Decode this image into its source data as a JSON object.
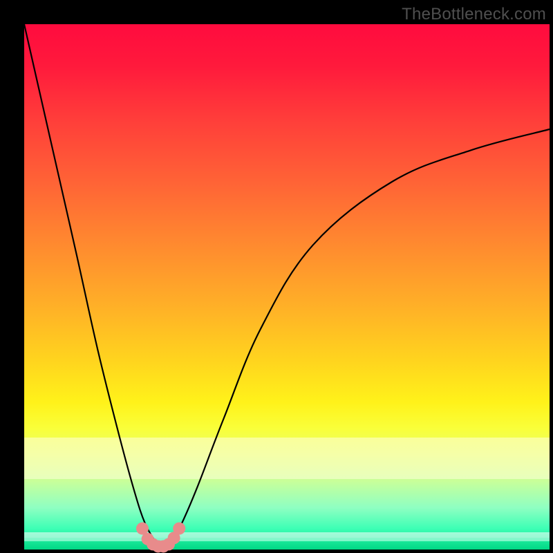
{
  "watermark": "TheBottleneck.com",
  "colors": {
    "curve_stroke": "#000000",
    "marker_fill": "#e88b8b",
    "marker_stroke": "#c96464"
  },
  "chart_data": {
    "type": "line",
    "title": "",
    "xlabel": "",
    "ylabel": "",
    "xlim": [
      0,
      100
    ],
    "ylim": [
      0,
      100
    ],
    "grid": false,
    "series": [
      {
        "name": "bottleneck-curve",
        "x": [
          0,
          5,
          10,
          14,
          18,
          21,
          23,
          25,
          26,
          27,
          28,
          30,
          33,
          38,
          45,
          55,
          70,
          85,
          100
        ],
        "values": [
          100,
          78,
          56,
          38,
          22,
          11,
          5,
          1.5,
          0.5,
          0.5,
          1.5,
          5,
          12,
          25,
          42,
          58,
          70,
          76,
          80
        ]
      }
    ],
    "markers": {
      "name": "low-region-dots",
      "x": [
        22.5,
        23.5,
        24.5,
        25.5,
        26.5,
        27.5,
        28.5,
        29.5
      ],
      "values": [
        4.0,
        2.0,
        1.0,
        0.6,
        0.6,
        1.0,
        2.2,
        4.0
      ]
    }
  }
}
